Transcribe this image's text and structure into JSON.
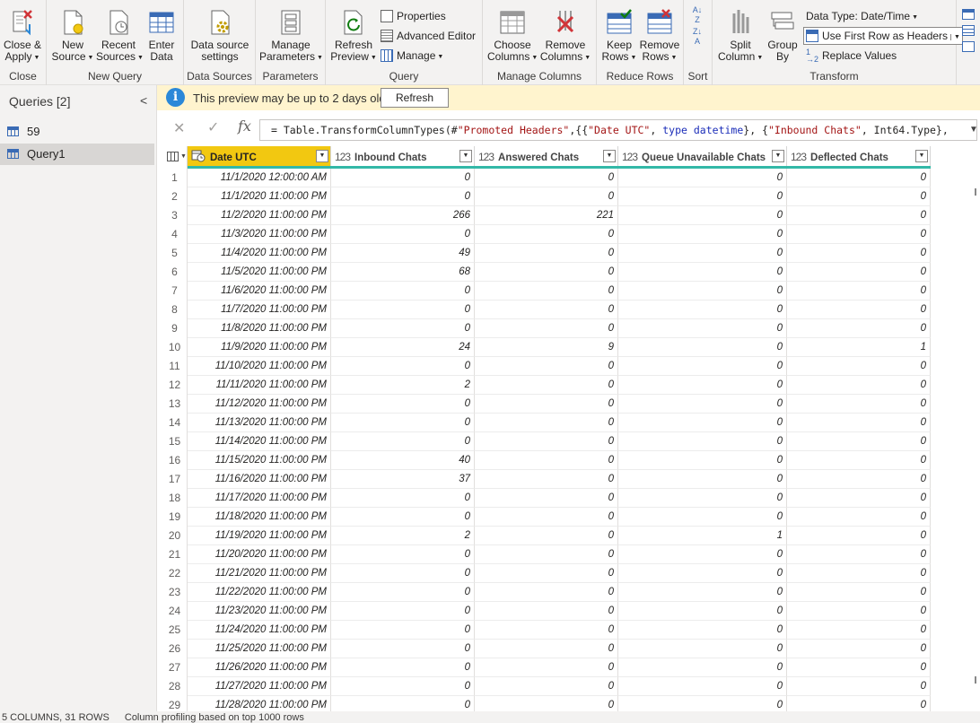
{
  "ribbon": {
    "groups": {
      "close": "Close",
      "new_query": "New Query",
      "data_sources": "Data Sources",
      "parameters": "Parameters",
      "query": "Query",
      "manage_columns": "Manage Columns",
      "reduce_rows": "Reduce Rows",
      "sort": "Sort",
      "transform": "Transform"
    },
    "buttons": {
      "close_apply": [
        "Close &",
        "Apply"
      ],
      "new_source": [
        "New",
        "Source"
      ],
      "recent_sources": [
        "Recent",
        "Sources"
      ],
      "enter_data": [
        "Enter",
        "Data"
      ],
      "data_source_settings": [
        "Data source",
        "settings"
      ],
      "manage_parameters": [
        "Manage",
        "Parameters"
      ],
      "refresh_preview": [
        "Refresh",
        "Preview"
      ],
      "properties": "Properties",
      "advanced_editor": "Advanced Editor",
      "manage": "Manage",
      "choose_columns": [
        "Choose",
        "Columns"
      ],
      "remove_columns": [
        "Remove",
        "Columns"
      ],
      "keep_rows": [
        "Keep",
        "Rows"
      ],
      "remove_rows": [
        "Remove",
        "Rows"
      ],
      "split_column": [
        "Split",
        "Column"
      ],
      "group_by": [
        "Group",
        "By"
      ],
      "data_type": "Data Type: Date/Time",
      "use_first_row": "Use First Row as Headers",
      "replace_values": "Replace Values"
    }
  },
  "queries": {
    "header": "Queries [2]",
    "items": [
      "59",
      "Query1"
    ],
    "selected": "Query1"
  },
  "notice": {
    "text": "This preview may be up to 2 days old.",
    "button": "Refresh"
  },
  "formula": {
    "prefix": "= Table.TransformColumnTypes(#",
    "s1": "\"Promoted Headers\"",
    "p2": ",{{",
    "s2": "\"Date UTC\"",
    "p3": ", ",
    "k1": "type",
    "p4": " ",
    "k2": "datetime",
    "p5": "}, {",
    "s3": "\"Inbound Chats\"",
    "p6": ", Int64.Type},"
  },
  "table": {
    "columns": [
      {
        "name": "Date UTC",
        "type_icon": "datetime-icon"
      },
      {
        "name": "Inbound Chats",
        "type_icon": "123"
      },
      {
        "name": "Answered Chats",
        "type_icon": "123"
      },
      {
        "name": "Queue Unavailable Chats",
        "type_icon": "123"
      },
      {
        "name": "Deflected Chats",
        "type_icon": "123"
      }
    ],
    "rows": [
      [
        "11/1/2020 12:00:00 AM",
        "0",
        "0",
        "0",
        "0"
      ],
      [
        "11/1/2020 11:00:00 PM",
        "0",
        "0",
        "0",
        "0"
      ],
      [
        "11/2/2020 11:00:00 PM",
        "266",
        "221",
        "0",
        "0"
      ],
      [
        "11/3/2020 11:00:00 PM",
        "0",
        "0",
        "0",
        "0"
      ],
      [
        "11/4/2020 11:00:00 PM",
        "49",
        "0",
        "0",
        "0"
      ],
      [
        "11/5/2020 11:00:00 PM",
        "68",
        "0",
        "0",
        "0"
      ],
      [
        "11/6/2020 11:00:00 PM",
        "0",
        "0",
        "0",
        "0"
      ],
      [
        "11/7/2020 11:00:00 PM",
        "0",
        "0",
        "0",
        "0"
      ],
      [
        "11/8/2020 11:00:00 PM",
        "0",
        "0",
        "0",
        "0"
      ],
      [
        "11/9/2020 11:00:00 PM",
        "24",
        "9",
        "0",
        "1"
      ],
      [
        "11/10/2020 11:00:00 PM",
        "0",
        "0",
        "0",
        "0"
      ],
      [
        "11/11/2020 11:00:00 PM",
        "2",
        "0",
        "0",
        "0"
      ],
      [
        "11/12/2020 11:00:00 PM",
        "0",
        "0",
        "0",
        "0"
      ],
      [
        "11/13/2020 11:00:00 PM",
        "0",
        "0",
        "0",
        "0"
      ],
      [
        "11/14/2020 11:00:00 PM",
        "0",
        "0",
        "0",
        "0"
      ],
      [
        "11/15/2020 11:00:00 PM",
        "40",
        "0",
        "0",
        "0"
      ],
      [
        "11/16/2020 11:00:00 PM",
        "37",
        "0",
        "0",
        "0"
      ],
      [
        "11/17/2020 11:00:00 PM",
        "0",
        "0",
        "0",
        "0"
      ],
      [
        "11/18/2020 11:00:00 PM",
        "0",
        "0",
        "0",
        "0"
      ],
      [
        "11/19/2020 11:00:00 PM",
        "2",
        "0",
        "1",
        "0"
      ],
      [
        "11/20/2020 11:00:00 PM",
        "0",
        "0",
        "0",
        "0"
      ],
      [
        "11/21/2020 11:00:00 PM",
        "0",
        "0",
        "0",
        "0"
      ],
      [
        "11/22/2020 11:00:00 PM",
        "0",
        "0",
        "0",
        "0"
      ],
      [
        "11/23/2020 11:00:00 PM",
        "0",
        "0",
        "0",
        "0"
      ],
      [
        "11/24/2020 11:00:00 PM",
        "0",
        "0",
        "0",
        "0"
      ],
      [
        "11/25/2020 11:00:00 PM",
        "0",
        "0",
        "0",
        "0"
      ],
      [
        "11/26/2020 11:00:00 PM",
        "0",
        "0",
        "0",
        "0"
      ],
      [
        "11/27/2020 11:00:00 PM",
        "0",
        "0",
        "0",
        "0"
      ],
      [
        "11/28/2020 11:00:00 PM",
        "0",
        "0",
        "0",
        "0"
      ]
    ]
  },
  "status": {
    "columns_rows": "5 COLUMNS, 31 ROWS",
    "profiling": "Column profiling based on top 1000 rows"
  },
  "colors": {
    "selected_header": "#f2c811",
    "quality_bar": "#33b8a7",
    "notice_bg": "#fff4ce",
    "info_icon": "#2b88d8"
  }
}
